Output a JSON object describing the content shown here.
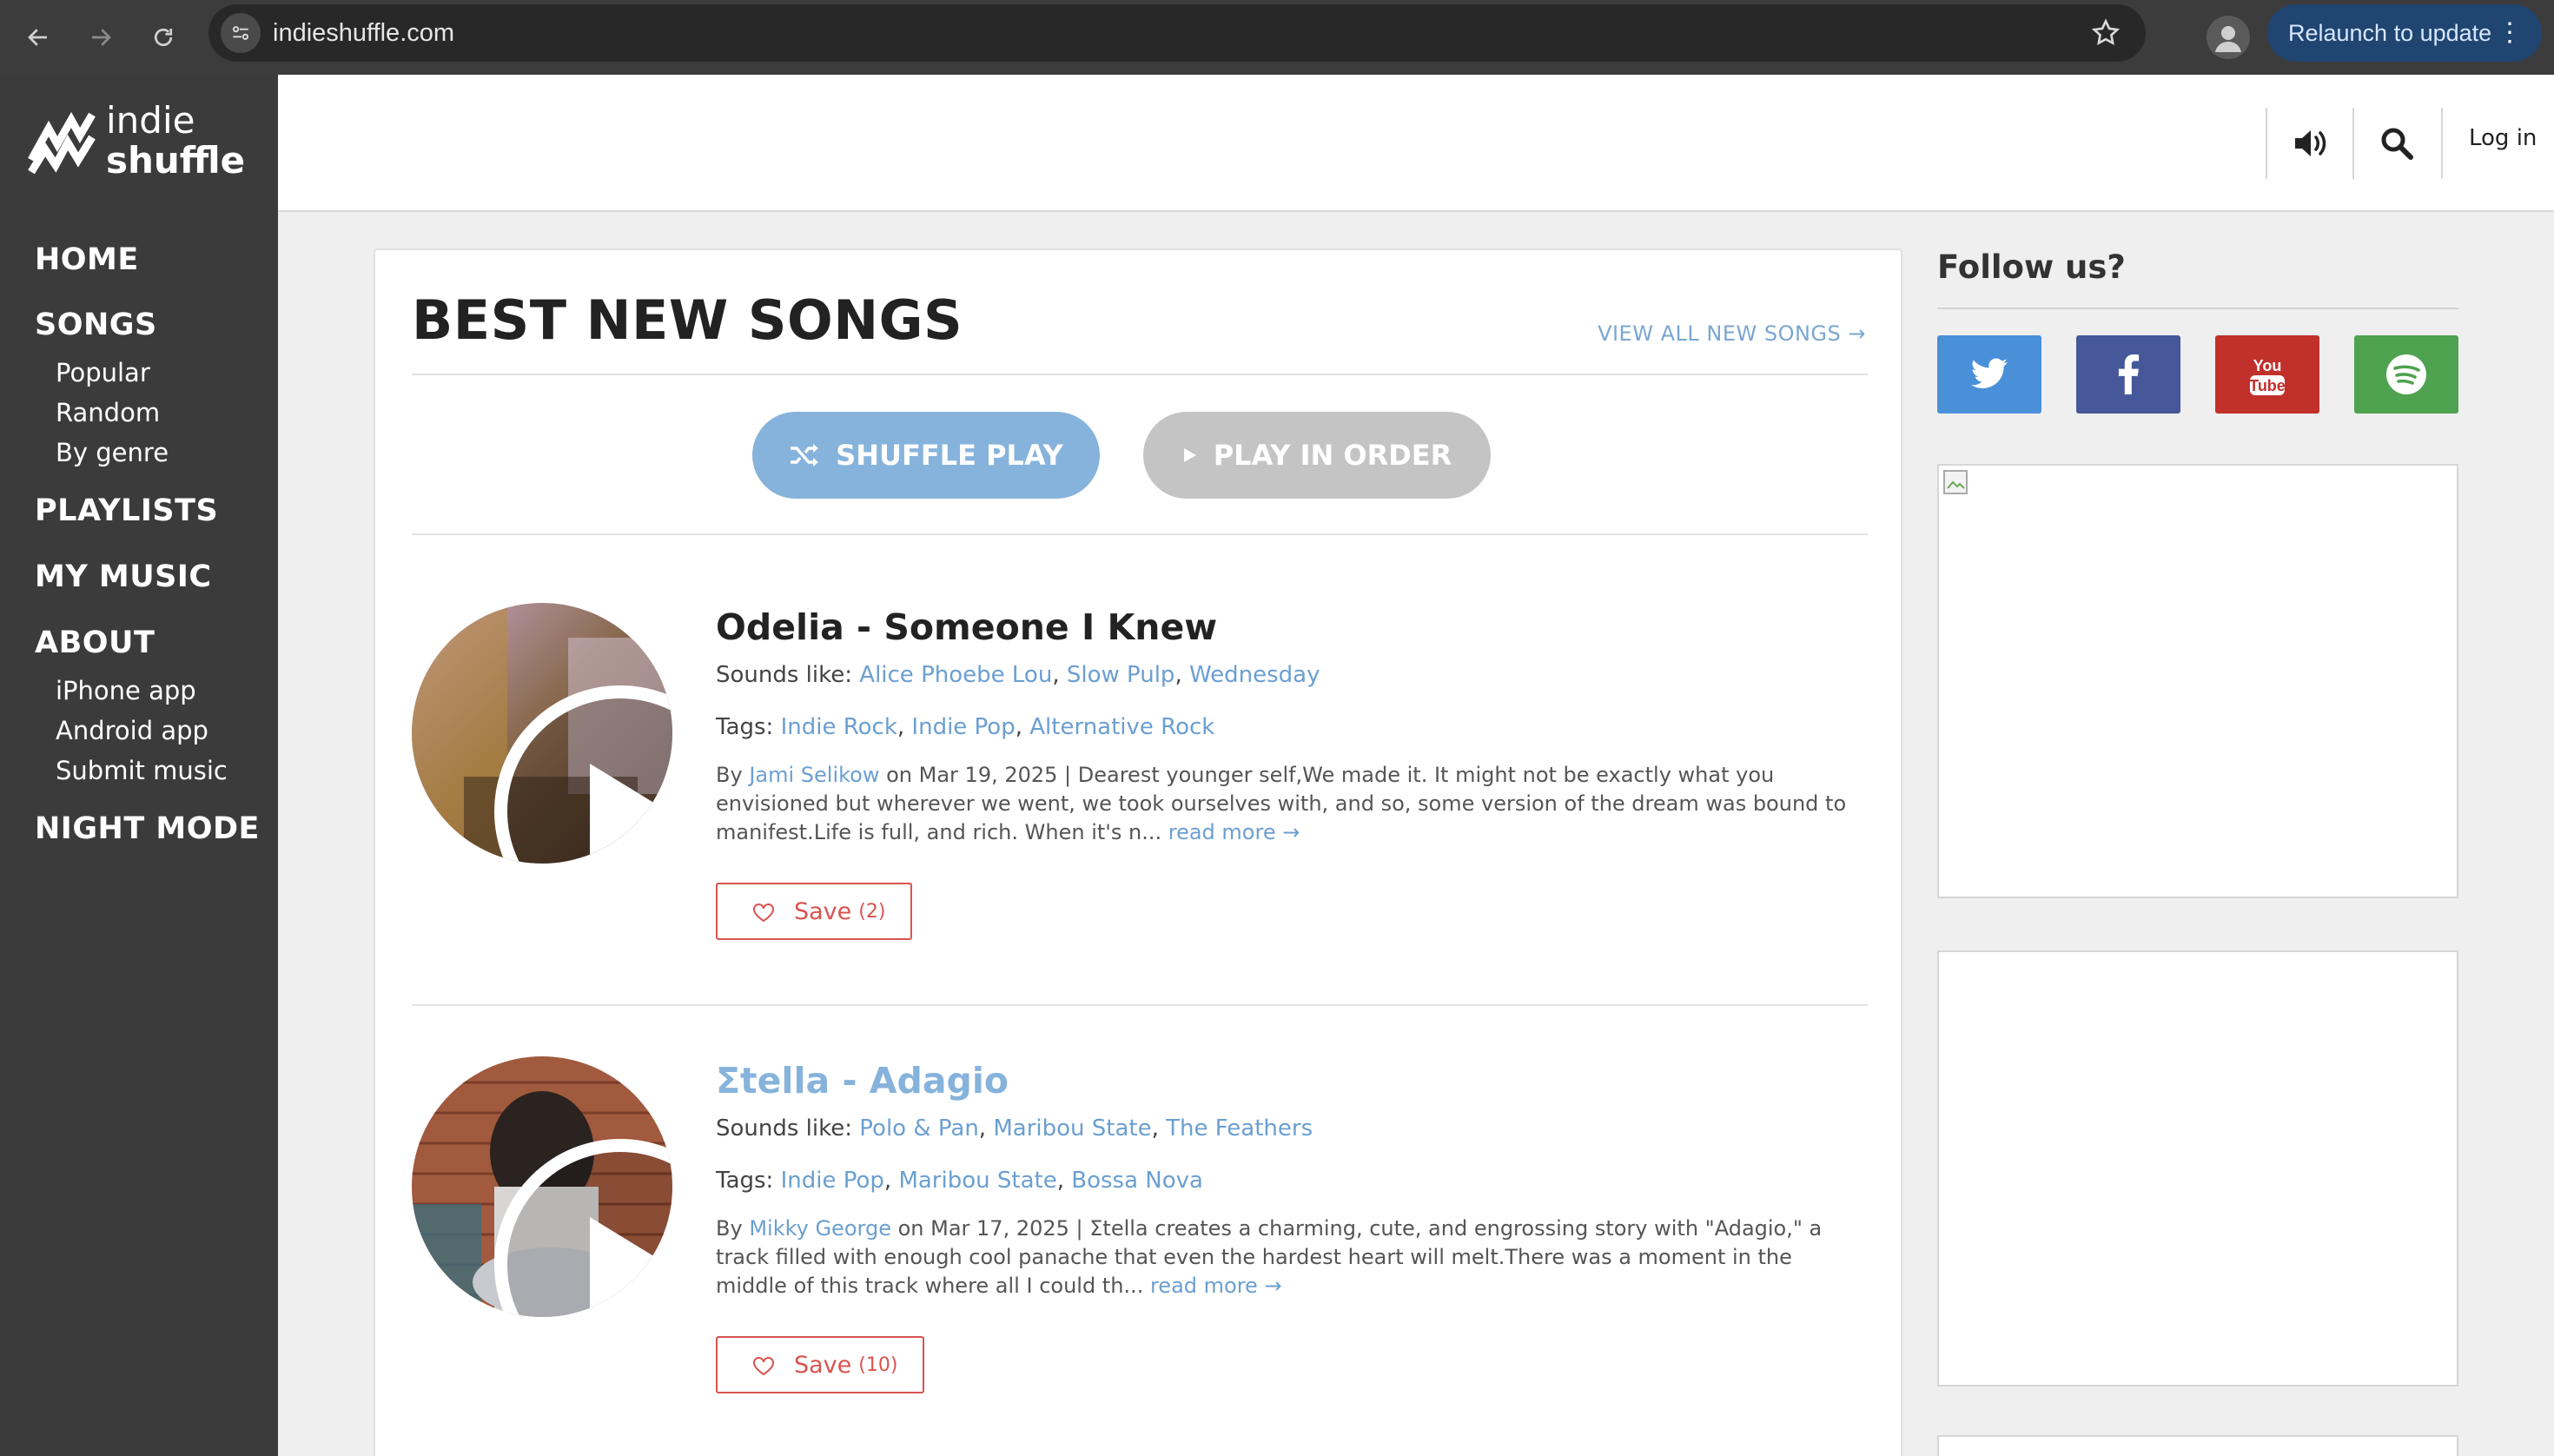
{
  "browser": {
    "url": "indieshuffle.com",
    "relaunch_label": "Relaunch to update",
    "menu_glyph": "⋮"
  },
  "site": {
    "logo_line1": "indie",
    "logo_line2": "shuffle",
    "login_label": "Log in"
  },
  "sidebar": {
    "home": "HOME",
    "songs": "SONGS",
    "songs_items": [
      "Popular",
      "Random",
      "By genre"
    ],
    "playlists": "PLAYLISTS",
    "my_music": "MY MUSIC",
    "about": "ABOUT",
    "about_items": [
      "iPhone app",
      "Android app",
      "Submit music"
    ],
    "night_mode": "NIGHT MODE"
  },
  "main": {
    "title": "BEST NEW SONGS",
    "view_all": "VIEW ALL NEW SONGS →",
    "shuffle_label": "SHUFFLE PLAY",
    "order_label": "PLAY IN ORDER",
    "sounds_like_label": "Sounds like:",
    "tags_label": "Tags:",
    "by_label": "By",
    "read_more": "read more →",
    "save_label": "Save",
    "songs": [
      {
        "title": "Odelia - Someone I Knew",
        "sounds_like": [
          "Alice Phoebe Lou",
          "Slow Pulp",
          "Wednesday"
        ],
        "tags": [
          "Indie Rock",
          "Indie Pop",
          "Alternative Rock"
        ],
        "author": "Jami Selikow",
        "date_text": "on Mar 19, 2025 | Dearest younger self,We made it. It might not be exactly what you envisioned but wherever we went, we took ourselves with, and so, some version of the dream was bound to manifest.Life is full, and rich. When it's n...",
        "save_count": "(2)"
      },
      {
        "title": "Σtella - Adagio",
        "sounds_like": [
          "Polo & Pan",
          "Maribou State",
          "The Feathers"
        ],
        "tags": [
          "Indie Pop",
          "Maribou State",
          "Bossa Nova"
        ],
        "author": "Mikky George",
        "date_text": "on Mar 17, 2025 | Σtella creates a charming, cute, and engrossing story with \"Adagio,\" a track filled with enough cool panache that even the hardest heart will melt.There was a moment in the middle of this track where all I could th...",
        "save_count": "(10)"
      }
    ]
  },
  "aside": {
    "follow_title": "Follow us?",
    "socials": [
      "twitter",
      "facebook",
      "youtube",
      "spotify"
    ],
    "youtube_text_1": "You",
    "youtube_text_2": "Tube"
  },
  "colors": {
    "accent_link": "#6b9fd1",
    "shuffle_button": "#86b3db",
    "order_button": "#c4c4c4",
    "save_red": "#d9534f",
    "twitter": "#4a90d9",
    "facebook": "#46589a",
    "youtube": "#c1302b",
    "spotify": "#4fa24f"
  }
}
